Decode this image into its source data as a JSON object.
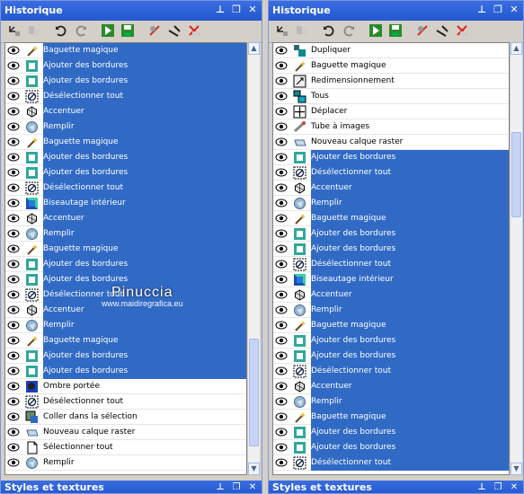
{
  "left": {
    "title": "Historique",
    "bottom_title": "Styles et textures",
    "rows": [
      {
        "label": "Baguette magique",
        "icon": "magic-wand-icon",
        "sel": true
      },
      {
        "label": "Ajouter des bordures",
        "icon": "border-icon",
        "sel": true
      },
      {
        "label": "Ajouter des bordures",
        "icon": "border-icon",
        "sel": true
      },
      {
        "label": "Désélectionner tout",
        "icon": "deselect-icon",
        "sel": true
      },
      {
        "label": "Accentuer",
        "icon": "sharpen-icon",
        "sel": true
      },
      {
        "label": "Remplir",
        "icon": "fill-icon",
        "sel": true
      },
      {
        "label": "Baguette magique",
        "icon": "magic-wand-icon",
        "sel": true
      },
      {
        "label": "Ajouter des bordures",
        "icon": "border-icon",
        "sel": true
      },
      {
        "label": "Ajouter des bordures",
        "icon": "border-icon",
        "sel": true
      },
      {
        "label": "Désélectionner tout",
        "icon": "deselect-icon",
        "sel": true
      },
      {
        "label": "Biseautage intérieur",
        "icon": "bevel-icon",
        "sel": true
      },
      {
        "label": "Accentuer",
        "icon": "sharpen-icon",
        "sel": true
      },
      {
        "label": "Remplir",
        "icon": "fill-icon",
        "sel": true
      },
      {
        "label": "Baguette magique",
        "icon": "magic-wand-icon",
        "sel": true
      },
      {
        "label": "Ajouter des bordures",
        "icon": "border-icon",
        "sel": true
      },
      {
        "label": "Ajouter des bordures",
        "icon": "border-icon",
        "sel": true
      },
      {
        "label": "Désélectionner tout",
        "icon": "deselect-icon",
        "sel": true
      },
      {
        "label": "Accentuer",
        "icon": "sharpen-icon",
        "sel": true
      },
      {
        "label": "Remplir",
        "icon": "fill-icon",
        "sel": true
      },
      {
        "label": "Baguette magique",
        "icon": "magic-wand-icon",
        "sel": true
      },
      {
        "label": "Ajouter des bordures",
        "icon": "border-icon",
        "sel": true
      },
      {
        "label": "Ajouter des bordures",
        "icon": "border-icon",
        "sel": true
      },
      {
        "label": "Ombre portée",
        "icon": "drop-shadow-icon",
        "sel": false
      },
      {
        "label": "Désélectionner tout",
        "icon": "deselect-icon",
        "sel": false
      },
      {
        "label": "Coller dans la sélection",
        "icon": "paste-icon",
        "sel": false
      },
      {
        "label": "Nouveau calque raster",
        "icon": "raster-layer-icon",
        "sel": false
      },
      {
        "label": "Sélectionner tout",
        "icon": "select-all-icon",
        "sel": false
      },
      {
        "label": "Remplir",
        "icon": "fill-icon",
        "sel": false
      }
    ]
  },
  "right": {
    "title": "Historique",
    "bottom_title": "Styles et textures",
    "rows": [
      {
        "label": "Dupliquer",
        "icon": "duplicate-icon",
        "sel": false
      },
      {
        "label": "Baguette magique",
        "icon": "magic-wand-icon",
        "sel": false
      },
      {
        "label": "Redimensionnement",
        "icon": "resize-icon",
        "sel": false
      },
      {
        "label": "Tous",
        "icon": "all-layers-icon",
        "sel": false
      },
      {
        "label": "Déplacer",
        "icon": "move-icon",
        "sel": false
      },
      {
        "label": "Tube à images",
        "icon": "picture-tube-icon",
        "sel": false
      },
      {
        "label": "Nouveau calque raster",
        "icon": "raster-layer-icon",
        "sel": false
      },
      {
        "label": "Ajouter des bordures",
        "icon": "border-icon",
        "sel": true
      },
      {
        "label": "Désélectionner tout",
        "icon": "deselect-icon",
        "sel": true
      },
      {
        "label": "Accentuer",
        "icon": "sharpen-icon",
        "sel": true
      },
      {
        "label": "Remplir",
        "icon": "fill-icon",
        "sel": true
      },
      {
        "label": "Baguette magique",
        "icon": "magic-wand-icon",
        "sel": true
      },
      {
        "label": "Ajouter des bordures",
        "icon": "border-icon",
        "sel": true
      },
      {
        "label": "Ajouter des bordures",
        "icon": "border-icon",
        "sel": true
      },
      {
        "label": "Désélectionner tout",
        "icon": "deselect-icon",
        "sel": true
      },
      {
        "label": "Biseautage intérieur",
        "icon": "bevel-icon",
        "sel": true
      },
      {
        "label": "Accentuer",
        "icon": "sharpen-icon",
        "sel": true
      },
      {
        "label": "Remplir",
        "icon": "fill-icon",
        "sel": true
      },
      {
        "label": "Baguette magique",
        "icon": "magic-wand-icon",
        "sel": true
      },
      {
        "label": "Ajouter des bordures",
        "icon": "border-icon",
        "sel": true
      },
      {
        "label": "Ajouter des bordures",
        "icon": "border-icon",
        "sel": true
      },
      {
        "label": "Désélectionner tout",
        "icon": "deselect-icon",
        "sel": true
      },
      {
        "label": "Accentuer",
        "icon": "sharpen-icon",
        "sel": true
      },
      {
        "label": "Remplir",
        "icon": "fill-icon",
        "sel": true
      },
      {
        "label": "Baguette magique",
        "icon": "magic-wand-icon",
        "sel": true
      },
      {
        "label": "Ajouter des bordures",
        "icon": "border-icon",
        "sel": true
      },
      {
        "label": "Ajouter des bordures",
        "icon": "border-icon",
        "sel": true
      },
      {
        "label": "Désélectionner tout",
        "icon": "deselect-icon",
        "sel": true
      }
    ]
  },
  "watermark": {
    "line1": "Pinuccia",
    "line2": "www.maidiregrafica.eu"
  },
  "colors": {
    "selection": "#316ac5",
    "title": "#2358d0",
    "panel_bg": "#d4d0c8"
  }
}
